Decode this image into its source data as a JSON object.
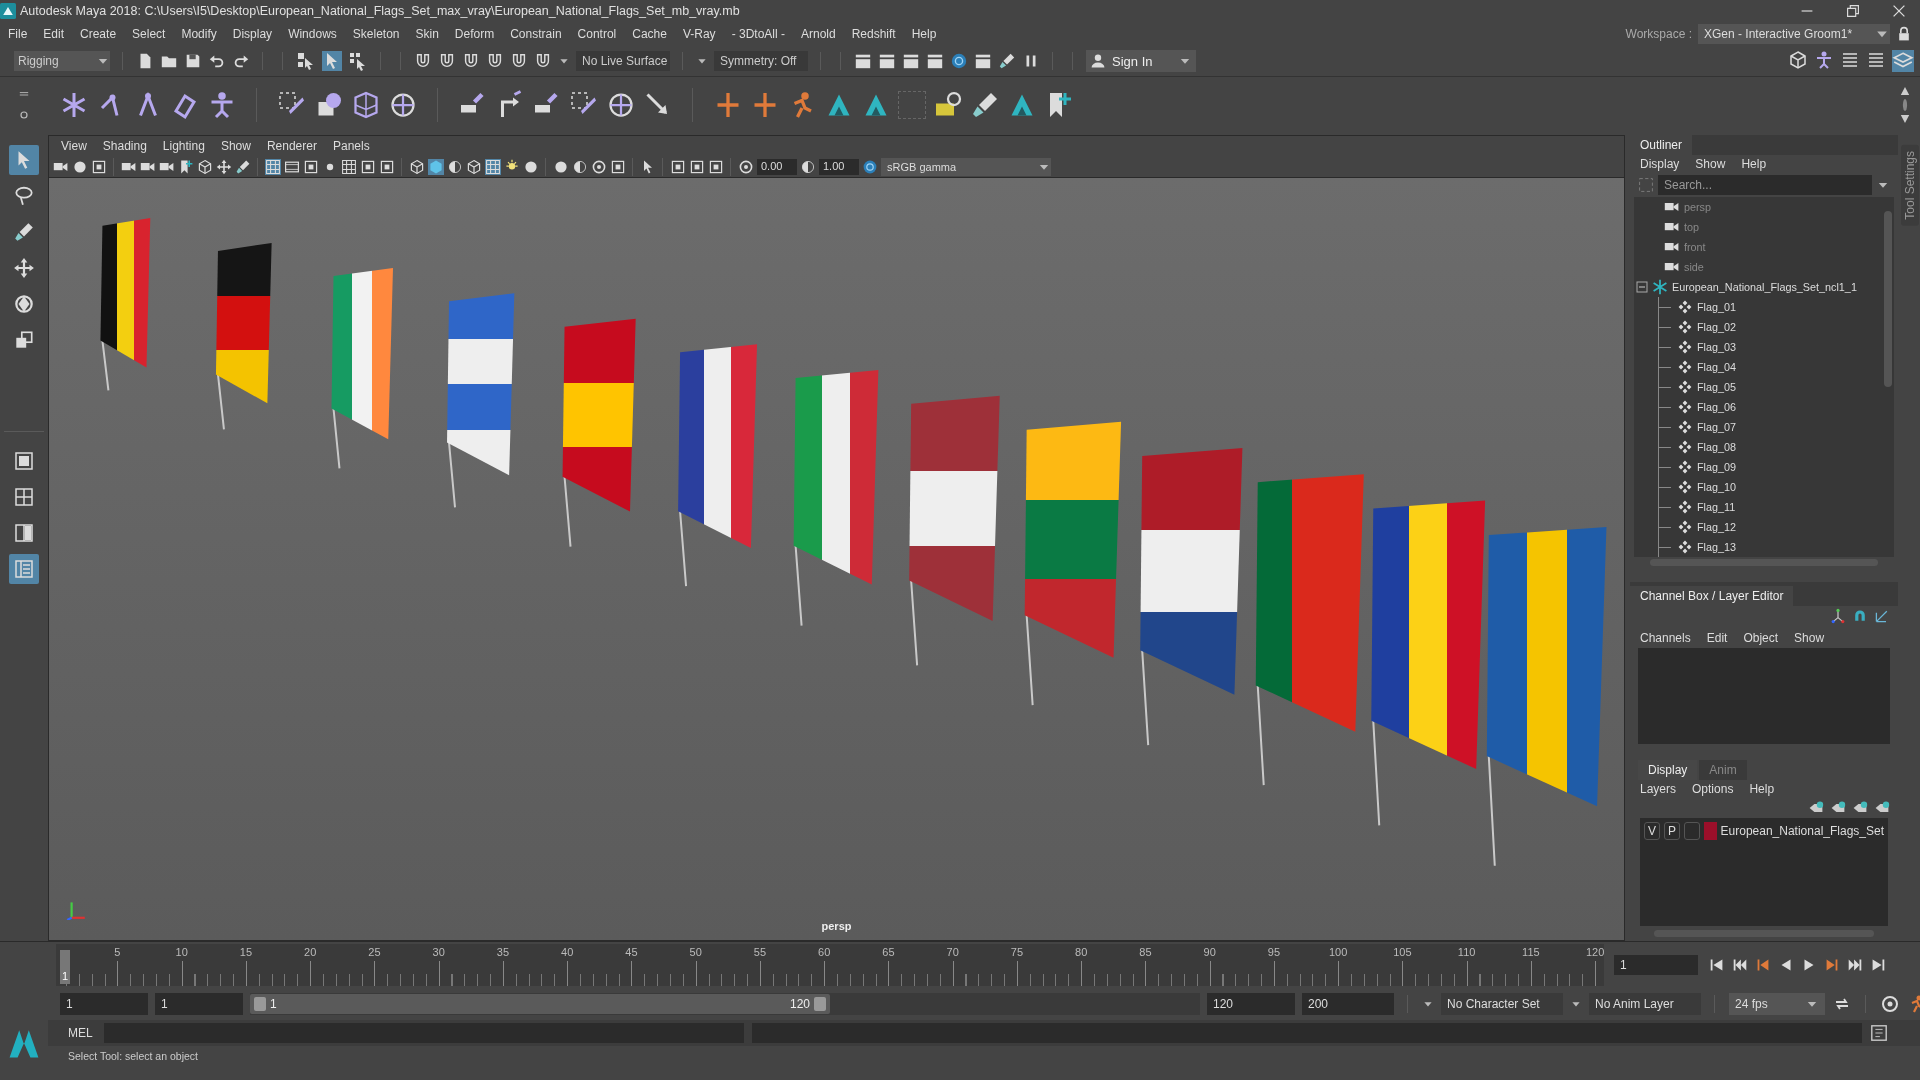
{
  "window": {
    "title": "Autodesk Maya 2018: C:\\Users\\I5\\Desktop\\European_National_Flags_Set_max_vray\\European_National_Flags_Set_mb_vray.mb"
  },
  "menu_bar": [
    "File",
    "Edit",
    "Create",
    "Select",
    "Modify",
    "Display",
    "Windows",
    "Skeleton",
    "Skin",
    "Deform",
    "Constrain",
    "Control",
    "Cache",
    "V-Ray",
    "- 3DtoAll -",
    "Arnold",
    "Redshift",
    "Help"
  ],
  "workspace": {
    "label": "Workspace :",
    "value": "XGen - Interactive Groom1*"
  },
  "status_line": {
    "menu_set": "Rigging",
    "live_surface": "No Live Surface",
    "symmetry": "Symmetry: Off",
    "sign_in": "Sign In"
  },
  "toolbox": {
    "tools": [
      {
        "selected": true
      },
      {
        "selected": false
      },
      {
        "selected": false
      },
      {
        "selected": false
      },
      {
        "selected": false
      },
      {
        "selected": false
      }
    ],
    "layouts": [
      {
        "selected": false
      },
      {
        "selected": false
      },
      {
        "selected": false
      },
      {
        "selected": true
      }
    ]
  },
  "viewport": {
    "menus": [
      "View",
      "Shading",
      "Lighting",
      "Show",
      "Renderer",
      "Panels"
    ],
    "exposure": "0.00",
    "gamma": "1.00",
    "color_space": "sRGB gamma",
    "camera": "persp"
  },
  "outliner": {
    "title": "Outliner",
    "menus": [
      "Display",
      "Show",
      "Help"
    ],
    "search": {
      "placeholder": "Search..."
    },
    "items": [
      {
        "kind": "camera",
        "name": "persp"
      },
      {
        "kind": "camera",
        "name": "top"
      },
      {
        "kind": "camera",
        "name": "front"
      },
      {
        "kind": "camera",
        "name": "side"
      },
      {
        "kind": "group",
        "name": "European_National_Flags_Set_ncl1_1",
        "expanded": true,
        "children": [
          {
            "kind": "mesh",
            "name": "Flag_01"
          },
          {
            "kind": "mesh",
            "name": "Flag_02"
          },
          {
            "kind": "mesh",
            "name": "Flag_03"
          },
          {
            "kind": "mesh",
            "name": "Flag_04"
          },
          {
            "kind": "mesh",
            "name": "Flag_05"
          },
          {
            "kind": "mesh",
            "name": "Flag_06"
          },
          {
            "kind": "mesh",
            "name": "Flag_07"
          },
          {
            "kind": "mesh",
            "name": "Flag_08"
          },
          {
            "kind": "mesh",
            "name": "Flag_09"
          },
          {
            "kind": "mesh",
            "name": "Flag_10"
          },
          {
            "kind": "mesh",
            "name": "Flag_11"
          },
          {
            "kind": "mesh",
            "name": "Flag_12"
          },
          {
            "kind": "mesh",
            "name": "Flag_13"
          }
        ]
      }
    ]
  },
  "tool_settings_tab": "Tool Settings",
  "channel_box": {
    "title": "Channel Box / Layer Editor",
    "menus": [
      "Channels",
      "Edit",
      "Object",
      "Show"
    ]
  },
  "layer_editor": {
    "tabs": [
      {
        "label": "Display",
        "selected": true
      },
      {
        "label": "Anim",
        "selected": false
      }
    ],
    "menus": [
      "Layers",
      "Options",
      "Help"
    ],
    "layers": [
      {
        "visible": "V",
        "playback": "P",
        "color": "#9b0f2a",
        "name": "European_National_Flags_Set"
      }
    ]
  },
  "time_slider": {
    "ticks": [
      "5",
      "10",
      "15",
      "20",
      "25",
      "30",
      "35",
      "40",
      "45",
      "50",
      "55",
      "60",
      "65",
      "70",
      "75",
      "80",
      "85",
      "90",
      "95",
      "100",
      "105",
      "110",
      "115",
      "120"
    ],
    "current_frame": "1",
    "frame_field": "1"
  },
  "range_slider": {
    "start": "1",
    "playback_start": "1",
    "handle_start": "1",
    "handle_end": "120",
    "playback_end": "120",
    "end": "200",
    "character_set": "No Character Set",
    "anim_layer": "No Anim Layer",
    "fps": "24 fps"
  },
  "command_line": {
    "language": "MEL"
  },
  "help_line": "Select Tool: select an object"
}
